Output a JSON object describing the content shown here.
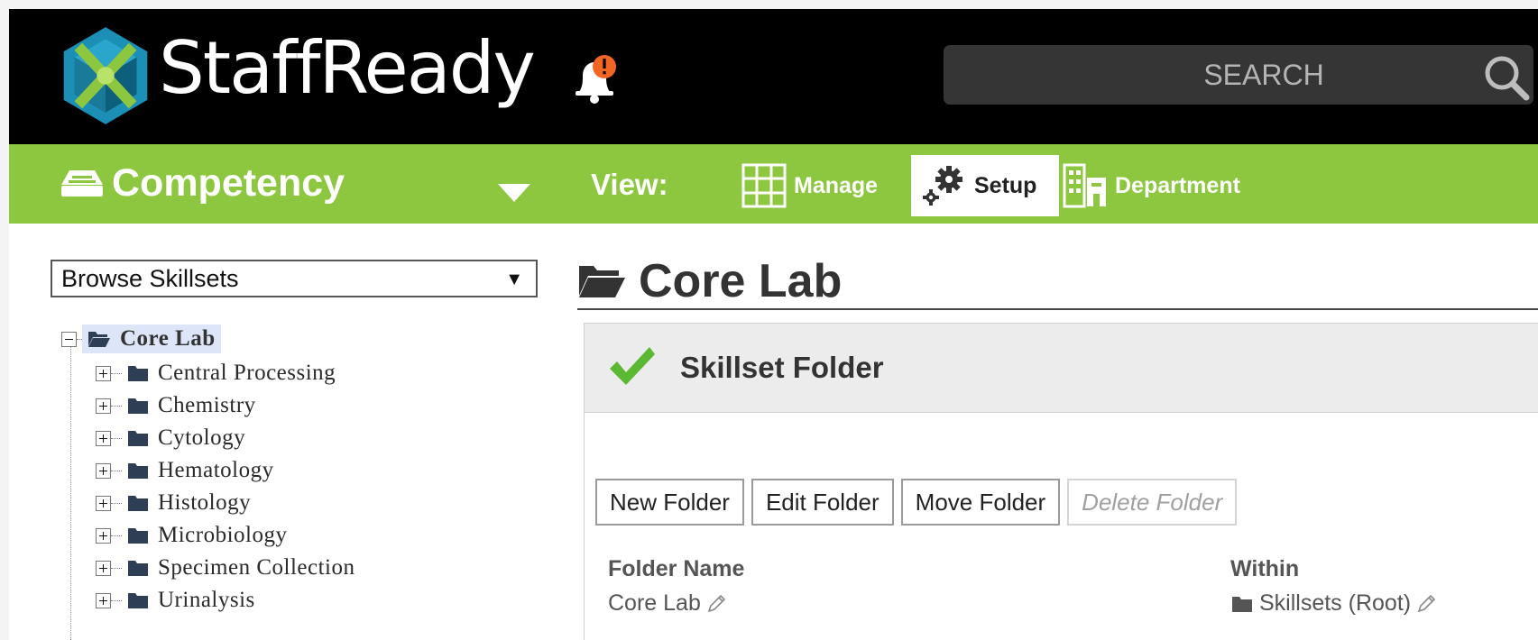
{
  "app": {
    "brand": "StaffReady"
  },
  "search": {
    "placeholder": "SEARCH"
  },
  "nav": {
    "module": "Competency",
    "view_label": "View:",
    "views": [
      {
        "label": "Manage",
        "active": false
      },
      {
        "label": "Setup",
        "active": true
      },
      {
        "label": "Department",
        "active": false
      }
    ]
  },
  "sidebar": {
    "browse_select": "Browse Skillsets",
    "tree": {
      "root": "Core Lab",
      "children": [
        "Central Processing",
        "Chemistry",
        "Cytology",
        "Hematology",
        "Histology",
        "Microbiology",
        "Specimen Collection",
        "Urinalysis"
      ]
    }
  },
  "main": {
    "title": "Core Lab",
    "panel_title": "Skillset Folder",
    "buttons": {
      "new": "New Folder",
      "edit": "Edit Folder",
      "move": "Move Folder",
      "delete": "Delete Folder"
    },
    "fields": {
      "folder_name_label": "Folder Name",
      "folder_name_value": "Core Lab",
      "within_label": "Within",
      "within_value": "Skillsets (Root)"
    }
  },
  "colors": {
    "nav_green": "#8dc63f",
    "topbar": "#000000",
    "alert_orange": "#f26522",
    "check_green": "#5bb832"
  }
}
